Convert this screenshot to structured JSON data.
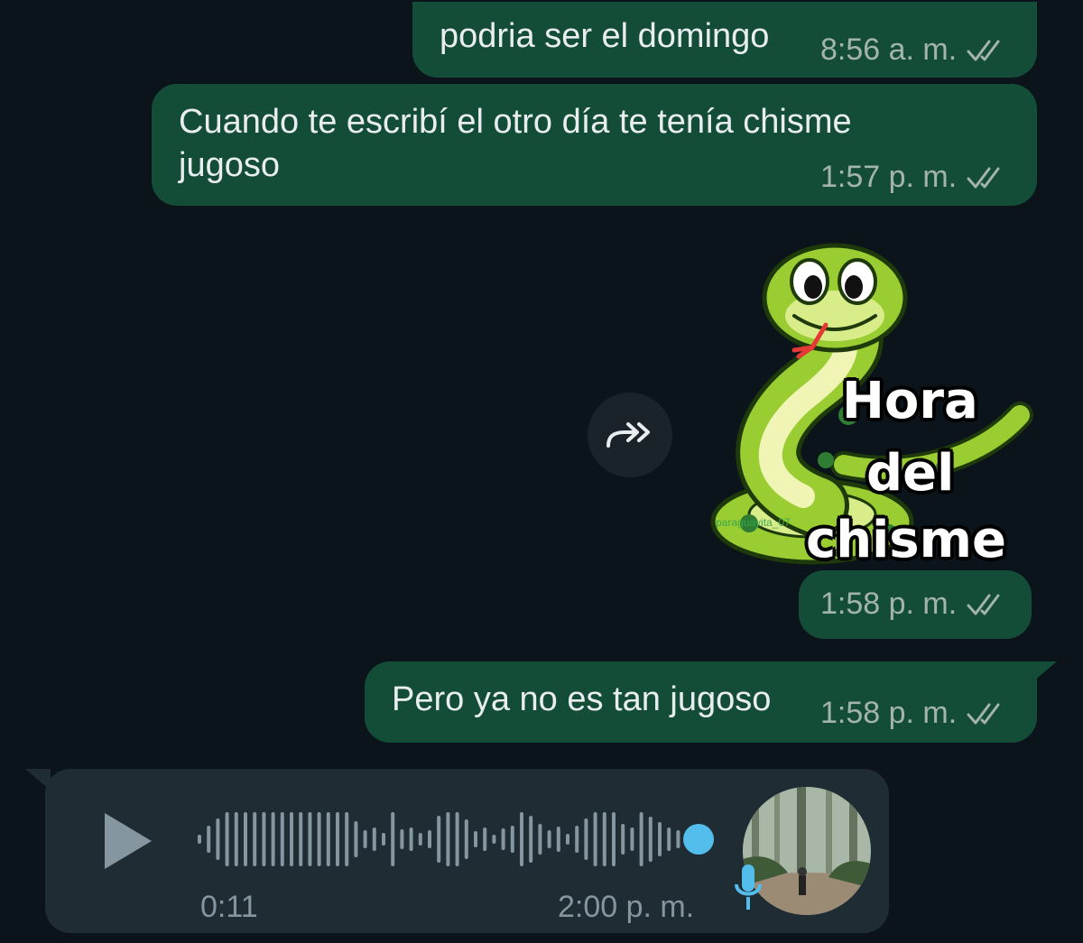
{
  "messages": [
    {
      "text": "podria ser el domingo",
      "time": "8:56 a. m."
    },
    {
      "text_line1": "Cuando te escribí el otro día te tenía chisme",
      "text_line2": "jugoso",
      "time": "1:57 p. m."
    },
    {
      "sticker": {
        "line1": "Hora",
        "line2": "del",
        "line3": "chisme",
        "watermark": "paraguayita_07"
      },
      "time": "1:58 p. m."
    },
    {
      "text": "Pero ya no es tan jugoso",
      "time": "1:58 p. m."
    }
  ],
  "voice_note": {
    "duration": "0:11",
    "time": "2:00 p. m."
  },
  "icons": {
    "read_receipt": "double-check-icon",
    "forward": "forward-icon",
    "play": "play-icon",
    "mic": "mic-icon"
  },
  "colors": {
    "background": "#0b141a",
    "outgoing_bubble": "#144d37",
    "incoming_bubble": "#1f2c34",
    "read_ticks": "#a3b3ad",
    "waveform": "#8696a0",
    "playhead": "#53bdeb"
  }
}
